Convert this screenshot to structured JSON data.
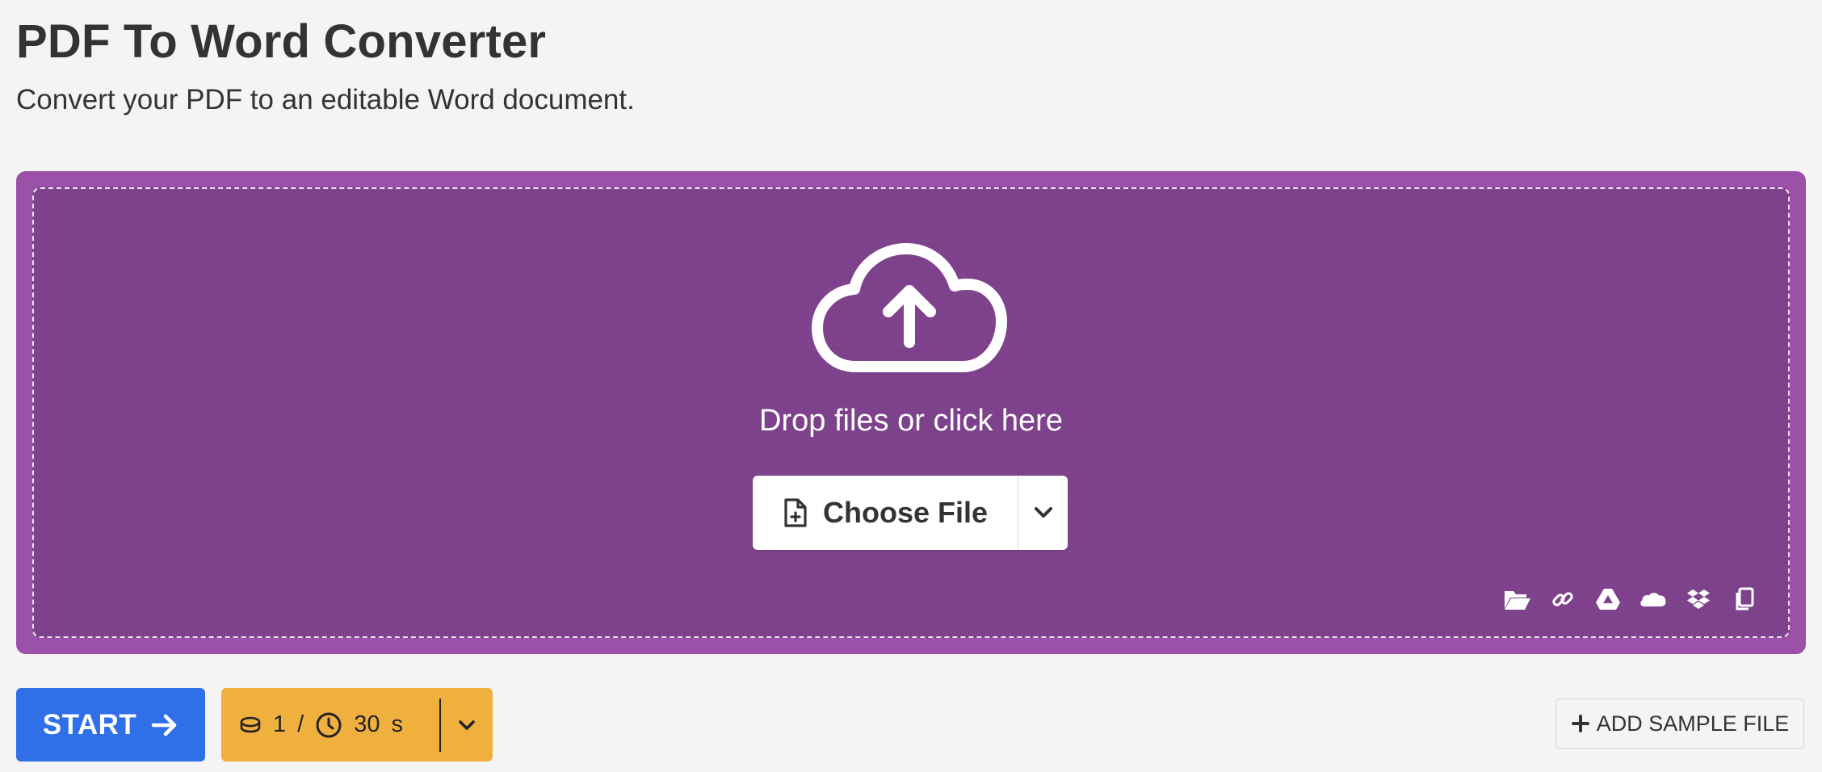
{
  "header": {
    "title": "PDF To Word Converter",
    "subtitle": "Convert your PDF to an editable Word document."
  },
  "dropzone": {
    "prompt": "Drop files or click here",
    "choose_file_label": "Choose File",
    "source_icons": [
      "folder-open-icon",
      "link-icon",
      "google-drive-icon",
      "onedrive-icon",
      "dropbox-icon",
      "clipboard-paste-icon"
    ]
  },
  "actions": {
    "start_label": "START",
    "credits_count": "1",
    "credits_separator": "/",
    "time_value": "30",
    "time_unit": "s",
    "add_sample_label": "ADD SAMPLE FILE"
  },
  "colors": {
    "dropzone_border": "#9b51a8",
    "dropzone_fill": "#7d428b",
    "start_button": "#2f6fe8",
    "credits_button": "#f0b03e",
    "background": "#f4f4f4"
  }
}
